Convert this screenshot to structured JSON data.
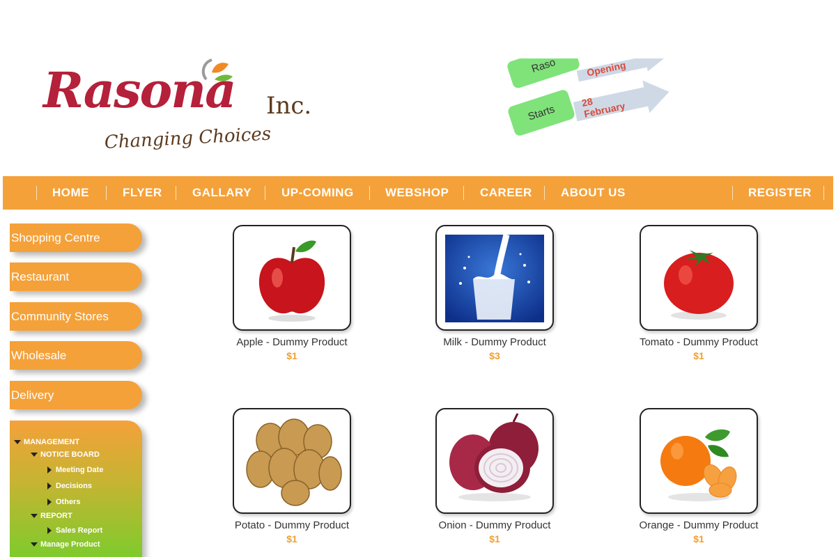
{
  "brand": {
    "name": "Rasona",
    "suffix": "Inc.",
    "tagline": "Changing Choices"
  },
  "promo": {
    "tag_top": "Raso",
    "arrow_top": "Opening",
    "tag_bottom": "Starts",
    "arrow_bottom_day": "28",
    "arrow_bottom_month": "February"
  },
  "nav": {
    "items": [
      "HOME",
      "FLYER",
      "GALLARY",
      "UP-COMING",
      "WEBSHOP",
      "CAREER",
      "ABOUT US"
    ],
    "register": "REGISTER"
  },
  "sidebar": {
    "buttons": [
      "Shopping Centre",
      "Restaurant",
      "Community Stores",
      "Wholesale",
      "Delivery"
    ],
    "tree": {
      "management": "MANAGEMENT",
      "notice_board": "NOTICE BOARD",
      "meeting_date": "Meeting Date",
      "decisions": "Decisions",
      "others": "Others",
      "report": "REPORT",
      "sales_report": "Sales Report",
      "manage_product": "Manage Product"
    }
  },
  "products": [
    {
      "name": "Apple - Dummy Product",
      "price": "$1",
      "icon": "apple-image"
    },
    {
      "name": "Milk - Dummy Product",
      "price": "$3",
      "icon": "milk-image"
    },
    {
      "name": "Tomato - Dummy Product",
      "price": "$1",
      "icon": "tomato-image"
    },
    {
      "name": "Potato - Dummy Product",
      "price": "$1",
      "icon": "potato-image"
    },
    {
      "name": "Onion - Dummy Product",
      "price": "$1",
      "icon": "onion-image"
    },
    {
      "name": "Orange - Dummy Product",
      "price": "$1",
      "icon": "orange-image"
    }
  ],
  "colors": {
    "accent": "#f4a13a",
    "brand_red": "#b5203a",
    "brand_brown": "#5b3a1e",
    "price": "#f0a030"
  }
}
